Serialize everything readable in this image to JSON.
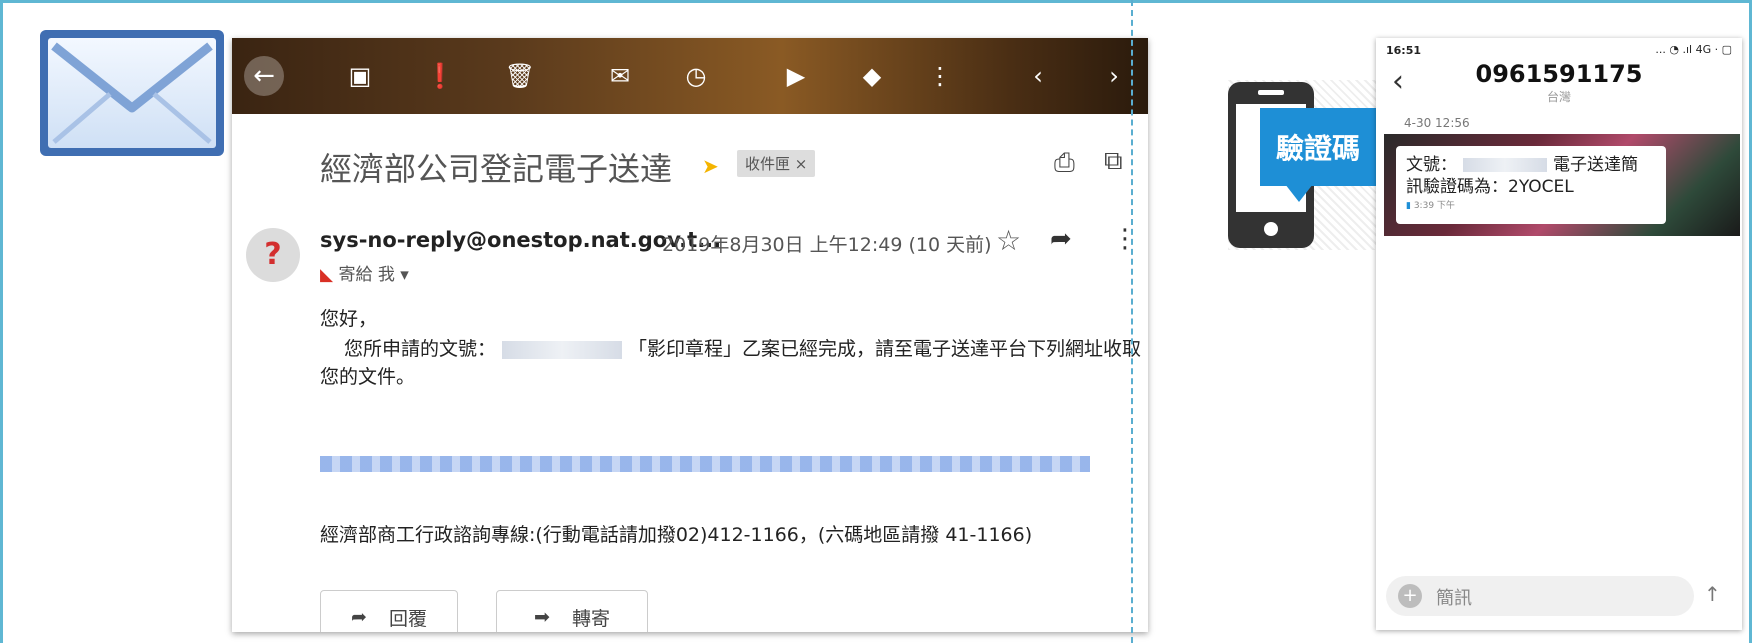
{
  "gmail": {
    "subject": "經濟部公司登記電子送達",
    "inbox_chip": "收件匣 ×",
    "sender": "sys-no-reply@onestop.nat.gov.t...",
    "date": "2019年8月30日 上午12:49 (10 天前)",
    "to": "寄給 我 ▾",
    "greeting": "您好，",
    "body_pre": "您所申請的文號：",
    "body_post": "「影印章程」乙案已經完成，請至電子送達平台下列網址收取",
    "body_line3": "您的文件。",
    "hotline": "經濟部商工行政諮詢專線:(行動電話請加撥02)412-1166，(六碼地區請撥 41-1166)",
    "reply_label": "回覆",
    "forward_label": "轉寄"
  },
  "badge": {
    "text": "驗證碼"
  },
  "sms": {
    "status_time": "16:51",
    "status_icons": "... ◔ .ıl 4G · ▢",
    "number": "0961591175",
    "sub": "台灣",
    "date": "4-30 12:56",
    "msg_pre": "文號：",
    "msg_post": "電子送達簡",
    "msg_line2": "訊驗證碼為：2YOCEL",
    "msg_meta": "3:39 下午",
    "input_placeholder": "簡訊"
  },
  "colors": {
    "frame": "#5fb7d3",
    "badge": "#1e8fd6",
    "envelope": "#3f6eb2"
  }
}
